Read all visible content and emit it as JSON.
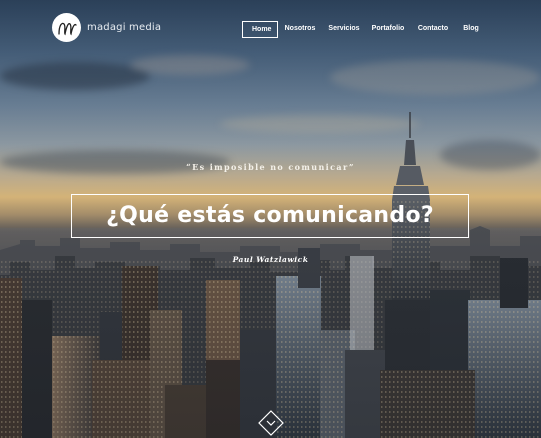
{
  "brand": {
    "name": "madagi media",
    "logo_letter": "m"
  },
  "nav": {
    "items": [
      {
        "label": "Home",
        "active": true
      },
      {
        "label": "Nosotros",
        "active": false
      },
      {
        "label": "Servicios",
        "active": false
      },
      {
        "label": "Portafolio",
        "active": false
      },
      {
        "label": "Contacto",
        "active": false
      },
      {
        "label": "Blog",
        "active": false
      }
    ]
  },
  "hero": {
    "quote": "“Es imposible no comunicar”",
    "headline": "¿Qué estás comunicando?",
    "author": "Paul Watzlawick",
    "background": "city skyline at sunset with Empire State Building"
  },
  "scroll_button": {
    "icon": "chevron-down-icon"
  },
  "colors": {
    "text": "#ffffff",
    "sky_top": "#2f4660",
    "horizon": "#d8b67a",
    "city": "#2a2f36"
  }
}
